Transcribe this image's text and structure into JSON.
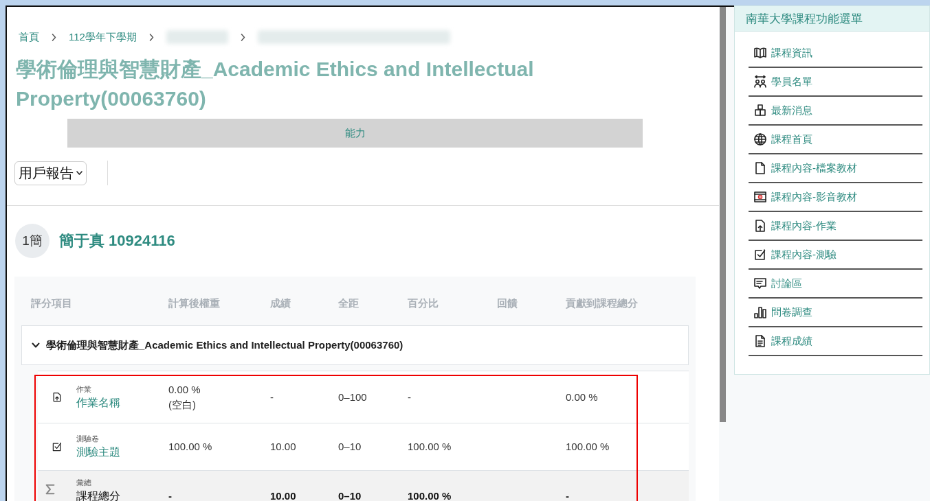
{
  "breadcrumb": [
    {
      "kind": "link",
      "label": "首頁"
    },
    {
      "kind": "link",
      "label": "112學年下學期"
    },
    {
      "kind": "redacted"
    },
    {
      "kind": "redacted"
    }
  ],
  "course_title": "學術倫理與智慧財產_Academic Ethics and Intellectual Property(00063760)",
  "tab_bar": {
    "label": "能力"
  },
  "report_select": {
    "value": "用戶報告"
  },
  "user": {
    "initials": "1簡",
    "name": "簡于真 10924116"
  },
  "grade_table": {
    "columns": [
      "評分項目",
      "計算後權重",
      "成績",
      "全距",
      "百分比",
      "回饋",
      "貢獻到課程總分"
    ],
    "category": {
      "label": "學術倫理與智慧財產_Academic Ethics and Intellectual Property(00063760)",
      "expanded": true
    },
    "rows": [
      {
        "kind": "assignment",
        "type_label": "作業",
        "name": "作業名稱",
        "weight": "0.00 %",
        "weight_note": "(空白)",
        "grade": "-",
        "range": "0–100",
        "percent": "-",
        "contribution": "0.00 %"
      },
      {
        "kind": "quiz",
        "type_label": "測驗卷",
        "name": "測驗主題",
        "weight": "100.00 %",
        "grade": "10.00",
        "range": "0–10",
        "percent": "100.00 %",
        "contribution": "100.00 %"
      },
      {
        "kind": "total",
        "type_label": "彙總",
        "name": "課程總分",
        "weight": "-",
        "grade": "10.00",
        "range": "0–10",
        "percent": "100.00 %",
        "contribution": "-"
      }
    ]
  },
  "sidebar": {
    "title": "南華大學課程功能選單",
    "items": [
      {
        "label": "課程資訊"
      },
      {
        "label": "學員名單"
      },
      {
        "label": "最新消息"
      },
      {
        "label": "課程首頁"
      },
      {
        "label": "課程內容-檔案教材"
      },
      {
        "label": "課程內容-影音教材"
      },
      {
        "label": "課程內容-作業"
      },
      {
        "label": "課程內容-測驗"
      },
      {
        "label": "討論區"
      },
      {
        "label": "問卷調查"
      },
      {
        "label": "課程成績"
      }
    ]
  }
}
